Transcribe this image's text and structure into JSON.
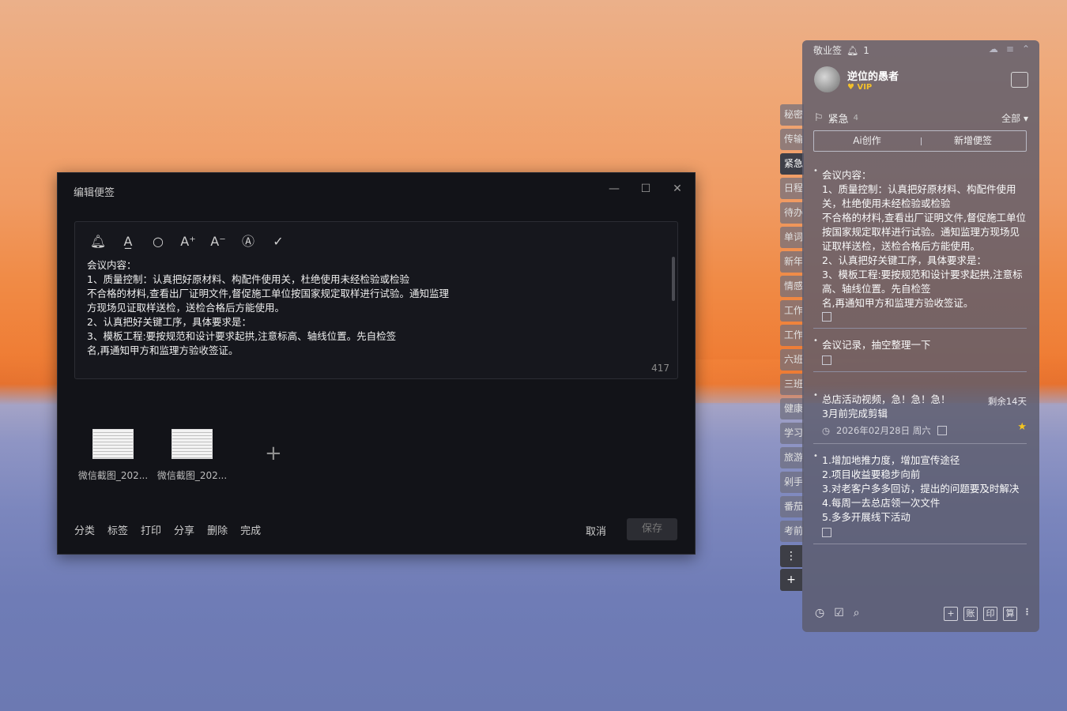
{
  "editor": {
    "title": "编辑便签",
    "window_controls": {
      "min": "—",
      "max": "☐",
      "close": "✕"
    },
    "toolbar_icons": [
      "bell-icon",
      "text-color-icon",
      "search-icon",
      "font-increase-icon",
      "font-decrease-icon",
      "text-format-icon",
      "check-icon"
    ],
    "content": "会议内容：\n1、质量控制：认真把好原材料、构配件使用关，杜绝使用未经检验或检验\n不合格的材料,查看出厂证明文件,督促施工单位按国家规定取样进行试验。通知监理\n方现场见证取样送检，送检合格后方能使用。\n2、认真把好关键工序，具体要求是：\n3、模板工程:要按规范和设计要求起拱,注意标高、轴线位置。先自检签\n名,再通知甲方和监理方验收签证。",
    "char_count": "417",
    "attachments": [
      {
        "caption": "微信截图_202..."
      },
      {
        "caption": "微信截图_202..."
      }
    ],
    "add_attachment": "+",
    "footer": {
      "classify": "分类",
      "tag": "标签",
      "print": "打印",
      "share": "分享",
      "delete": "删除",
      "done": "完成",
      "cancel": "取消",
      "save": "保存"
    }
  },
  "side_tabs": [
    "秘密",
    "传输",
    "紧急",
    "日程",
    "待办",
    "单词",
    "新年",
    "情感",
    "工作",
    "工作",
    "六班",
    "三班",
    "健康",
    "学习",
    "旅游",
    "剁手",
    "番茄",
    "考前"
  ],
  "side_tabs_active": "紧急",
  "side_tabs_more": "⋮",
  "side_tabs_add": "+",
  "panel": {
    "app_name": "敬业签",
    "notify_count": "1",
    "user_name": "逆位的愚者",
    "vip_label": "VIP",
    "category": "紧急",
    "category_count": "4",
    "filter": "全部",
    "ai_button": "Ai创作",
    "new_note_button": "新增便签",
    "remaining": "剩余14天",
    "notes": [
      {
        "text": "会议内容：\n1、质量控制：认真把好原材料、构配件使用关，杜绝使用未经检验或检验\n不合格的材料,查看出厂证明文件,督促施工单位按国家规定取样进行试验。通知监理方现场见证取样送检，送检合格后方能使用。\n2、认真把好关键工序，具体要求是：\n3、模板工程:要按规范和设计要求起拱,注意标高、轴线位置。先自检签\n名,再通知甲方和监理方验收签证。"
      },
      {
        "text": "会议记录，抽空整理一下"
      },
      {
        "text": "总店活动视频，急！急！急！\n3月前完成剪辑",
        "date": "2026年02月28日 周六"
      },
      {
        "text": "1.增加地推力度，增加宣传途径\n2.项目收益要稳步向前\n3.对老客户多多回访，提出的问题要及时解决\n4.每周一去总店领一次文件\n5.多多开展线下活动"
      }
    ],
    "footer_right": [
      "+",
      "账",
      "印",
      "算"
    ]
  }
}
